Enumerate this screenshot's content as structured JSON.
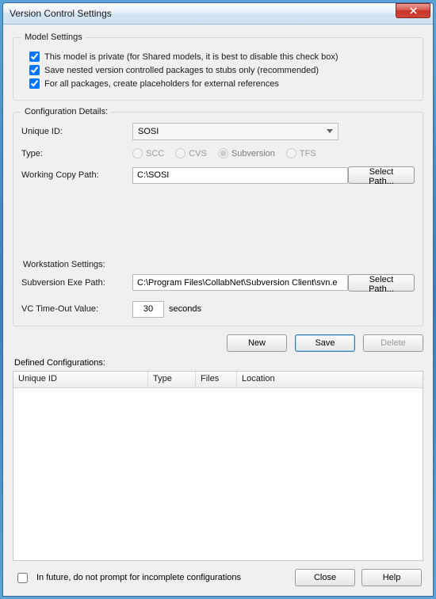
{
  "window": {
    "title": "Version Control Settings"
  },
  "model": {
    "legend": "Model Settings",
    "private": {
      "checked": true,
      "label": "This model is private (for Shared models, it is best to disable this check box)"
    },
    "stubs": {
      "checked": true,
      "label": "Save nested version controlled packages to stubs only (recommended)"
    },
    "placeholders": {
      "checked": true,
      "label": "For all packages, create placeholders for external references"
    }
  },
  "config": {
    "legend": "Configuration Details:",
    "uid_label": "Unique ID:",
    "uid_value": "SOSI",
    "type_label": "Type:",
    "types": {
      "scc": "SCC",
      "cvs": "CVS",
      "svn": "Subversion",
      "tfs": "TFS",
      "selected": "svn"
    },
    "wcp_label": "Working Copy Path:",
    "wcp_value": "C:\\SOSI",
    "select_path": "Select Path...",
    "ws_label": "Workstation Settings:",
    "svn_exe_label": "Subversion Exe Path:",
    "svn_exe_value": "C:\\Program Files\\CollabNet\\Subversion Client\\svn.e",
    "timeout_label": "VC Time-Out Value:",
    "timeout_value": "30",
    "timeout_unit": "seconds"
  },
  "buttons": {
    "new": "New",
    "save": "Save",
    "delete": "Delete",
    "close": "Close",
    "help": "Help"
  },
  "defined": {
    "label": "Defined Configurations:",
    "cols": {
      "uid": "Unique ID",
      "type": "Type",
      "files": "Files",
      "location": "Location"
    }
  },
  "footer": {
    "noprompt": {
      "checked": false,
      "label": "In future, do not prompt for incomplete configurations"
    }
  }
}
